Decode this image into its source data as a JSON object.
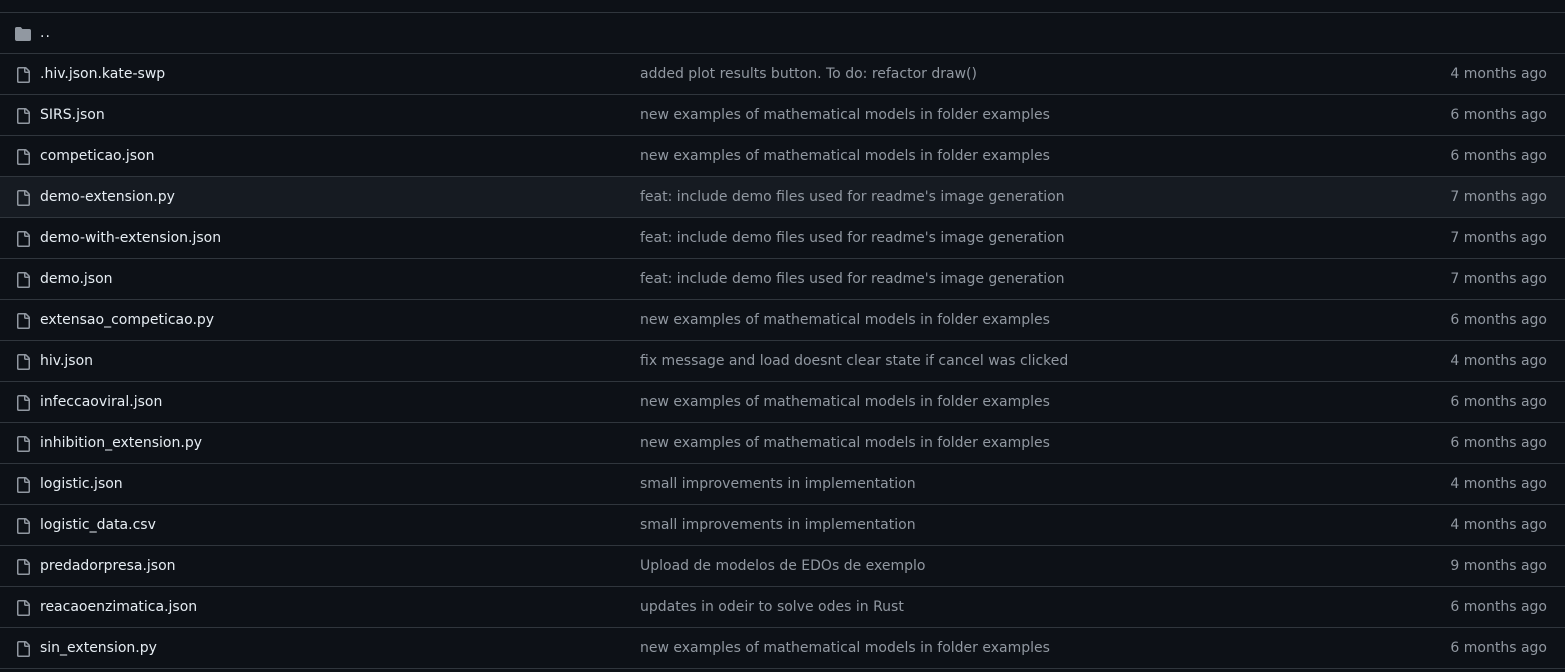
{
  "parent_dir": {
    "label": "..",
    "icon": "folder-icon"
  },
  "files": [
    {
      "name": ".hiv.json.kate-swp",
      "commit": "added plot results button. To do: refactor draw()",
      "age": "4 months ago",
      "icon": "file-icon"
    },
    {
      "name": "SIRS.json",
      "commit": "new examples of mathematical models in folder examples",
      "age": "6 months ago",
      "icon": "file-icon"
    },
    {
      "name": "competicao.json",
      "commit": "new examples of mathematical models in folder examples",
      "age": "6 months ago",
      "icon": "file-icon"
    },
    {
      "name": "demo-extension.py",
      "commit": "feat: include demo files used for readme's image generation",
      "age": "7 months ago",
      "icon": "file-icon"
    },
    {
      "name": "demo-with-extension.json",
      "commit": "feat: include demo files used for readme's image generation",
      "age": "7 months ago",
      "icon": "file-icon"
    },
    {
      "name": "demo.json",
      "commit": "feat: include demo files used for readme's image generation",
      "age": "7 months ago",
      "icon": "file-icon"
    },
    {
      "name": "extensao_competicao.py",
      "commit": "new examples of mathematical models in folder examples",
      "age": "6 months ago",
      "icon": "file-icon"
    },
    {
      "name": "hiv.json",
      "commit": "fix message and load doesnt clear state if cancel was clicked",
      "age": "4 months ago",
      "icon": "file-icon"
    },
    {
      "name": "infeccaoviral.json",
      "commit": "new examples of mathematical models in folder examples",
      "age": "6 months ago",
      "icon": "file-icon"
    },
    {
      "name": "inhibition_extension.py",
      "commit": "new examples of mathematical models in folder examples",
      "age": "6 months ago",
      "icon": "file-icon"
    },
    {
      "name": "logistic.json",
      "commit": "small improvements in implementation",
      "age": "4 months ago",
      "icon": "file-icon"
    },
    {
      "name": "logistic_data.csv",
      "commit": "small improvements in implementation",
      "age": "4 months ago",
      "icon": "file-icon"
    },
    {
      "name": "predadorpresa.json",
      "commit": "Upload de modelos de EDOs de exemplo",
      "age": "9 months ago",
      "icon": "file-icon"
    },
    {
      "name": "reacaoenzimatica.json",
      "commit": "updates in odeir to solve odes in Rust",
      "age": "6 months ago",
      "icon": "file-icon"
    },
    {
      "name": "sin_extension.py",
      "commit": "new examples of mathematical models in folder examples",
      "age": "6 months ago",
      "icon": "file-icon"
    }
  ],
  "colors": {
    "background": "#0d1117",
    "border": "#30363d",
    "text_primary": "#e6edf3",
    "text_muted": "#9198a1",
    "highlight_row": "#161b22"
  }
}
